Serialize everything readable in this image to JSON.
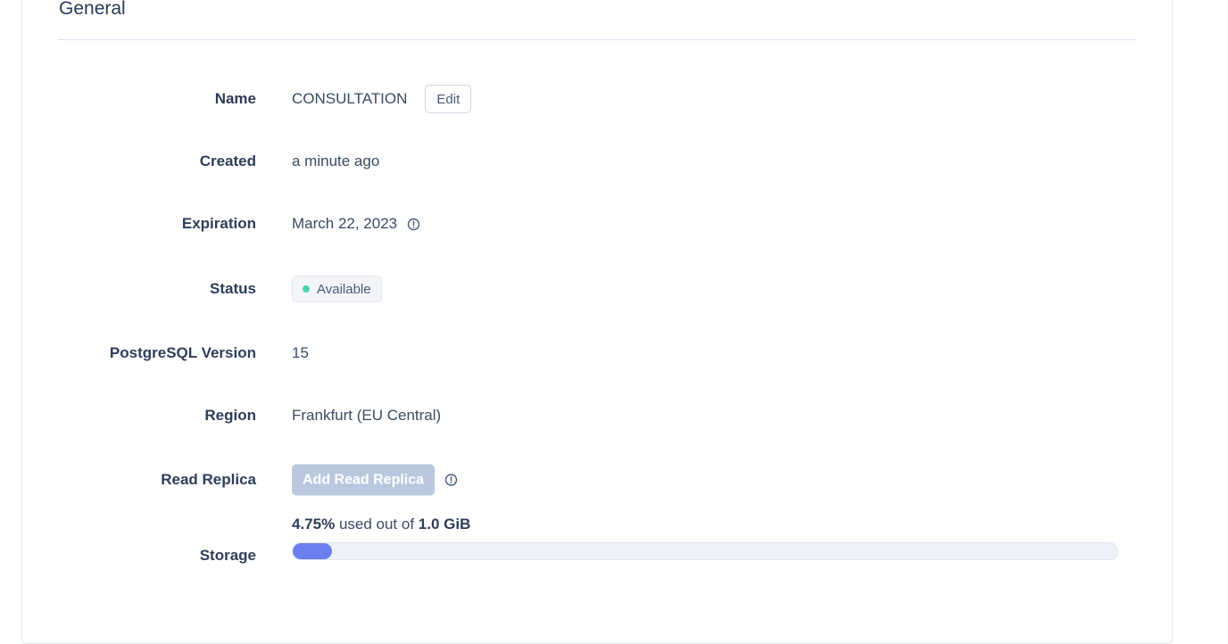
{
  "section": {
    "title": "General"
  },
  "fields": {
    "name": {
      "label": "Name",
      "value": "CONSULTATION",
      "edit_label": "Edit"
    },
    "created": {
      "label": "Created",
      "value": "a minute ago"
    },
    "expiration": {
      "label": "Expiration",
      "value": "March 22, 2023",
      "icon": "info-icon"
    },
    "status": {
      "label": "Status",
      "value": "Available",
      "dot_color": "#4fd1b0"
    },
    "version": {
      "label": "PostgreSQL Version",
      "value": "15"
    },
    "region": {
      "label": "Region",
      "value": "Frankfurt (EU Central)"
    },
    "read_replica": {
      "label": "Read Replica",
      "button_label": "Add Read Replica",
      "button_color": "#b9c8df",
      "icon": "info-icon"
    },
    "storage": {
      "label": "Storage",
      "percent_text": "4.75%",
      "used_text": "used out of",
      "total_text": "1.0 GiB",
      "percent_value": 4.75,
      "bar_color": "#6b7ff0"
    }
  }
}
